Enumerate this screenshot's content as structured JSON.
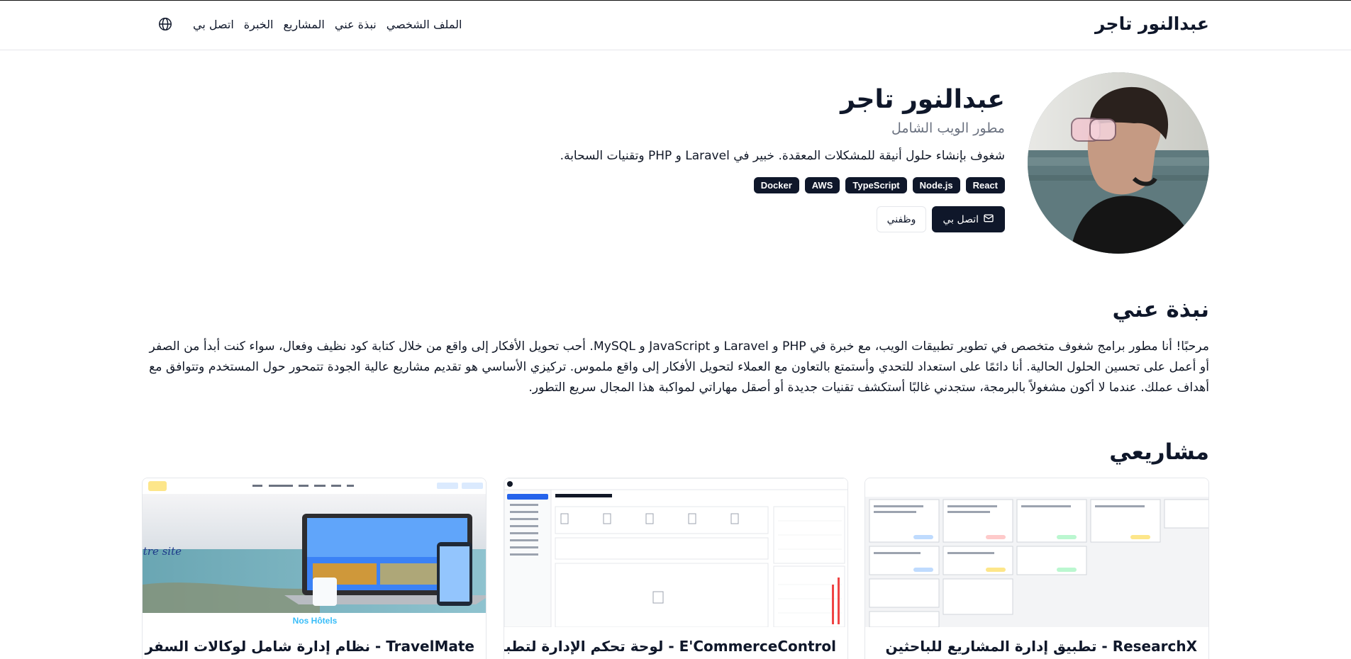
{
  "header": {
    "brand": "عبدالنور تاجر",
    "nav": [
      {
        "label": "الملف الشخصي"
      },
      {
        "label": "نبذة عني"
      },
      {
        "label": "المشاريع"
      },
      {
        "label": "الخبرة"
      },
      {
        "label": "اتصل بي"
      }
    ],
    "language_icon": "globe-icon"
  },
  "hero": {
    "name": "عبدالنور تاجر",
    "role": "مطور الويب الشامل",
    "description": "شغوف بإنشاء حلول أنيقة للمشكلات المعقدة. خبير في Laravel و PHP وتقنيات السحابة.",
    "skills": [
      "React",
      "Node.js",
      "TypeScript",
      "AWS",
      "Docker"
    ],
    "contact_button": "اتصل بي",
    "contact_icon": "mail-icon",
    "hire_button": "وظفني"
  },
  "about": {
    "title": "نبذة عني",
    "text": "مرحبًا! أنا مطور برامج شغوف متخصص في تطوير تطبيقات الويب، مع خبرة في PHP و Laravel و JavaScript و MySQL. أحب تحويل الأفكار إلى واقع من خلال كتابة كود نظيف وفعال، سواء كنت أبدأ من الصفر أو أعمل على تحسين الحلول الحالية. أنا دائمًا على استعداد للتحدي وأستمتع بالتعاون مع العملاء لتحويل الأفكار إلى واقع ملموس. تركيزي الأساسي هو تقديم مشاريع عالية الجودة تتمحور حول المستخدم وتتوافق مع أهداف عملك. عندما لا أكون مشغولاً بالبرمجة، ستجدني غالبًا أستكشف تقنيات جديدة أو أصقل مهاراتي لمواكبة هذا المجال سريع التطور."
  },
  "projects": {
    "title": "مشاريعي",
    "items": [
      {
        "title": "ResearchX - تطبيق إدارة المشاريع للباحثين"
      },
      {
        "title": "E'CommerceControl - لوحة تحكم الإدارة لتطبيقات"
      },
      {
        "title": "TravelMate - نظام إدارة شامل لوكالات السفر",
        "screenshot": {
          "slogan": "Réservez sur notre site",
          "section": "Nos Hôtels"
        }
      }
    ]
  },
  "colors": {
    "primary": "#0f172a",
    "muted": "#6b7280",
    "border": "#e5e7eb"
  }
}
